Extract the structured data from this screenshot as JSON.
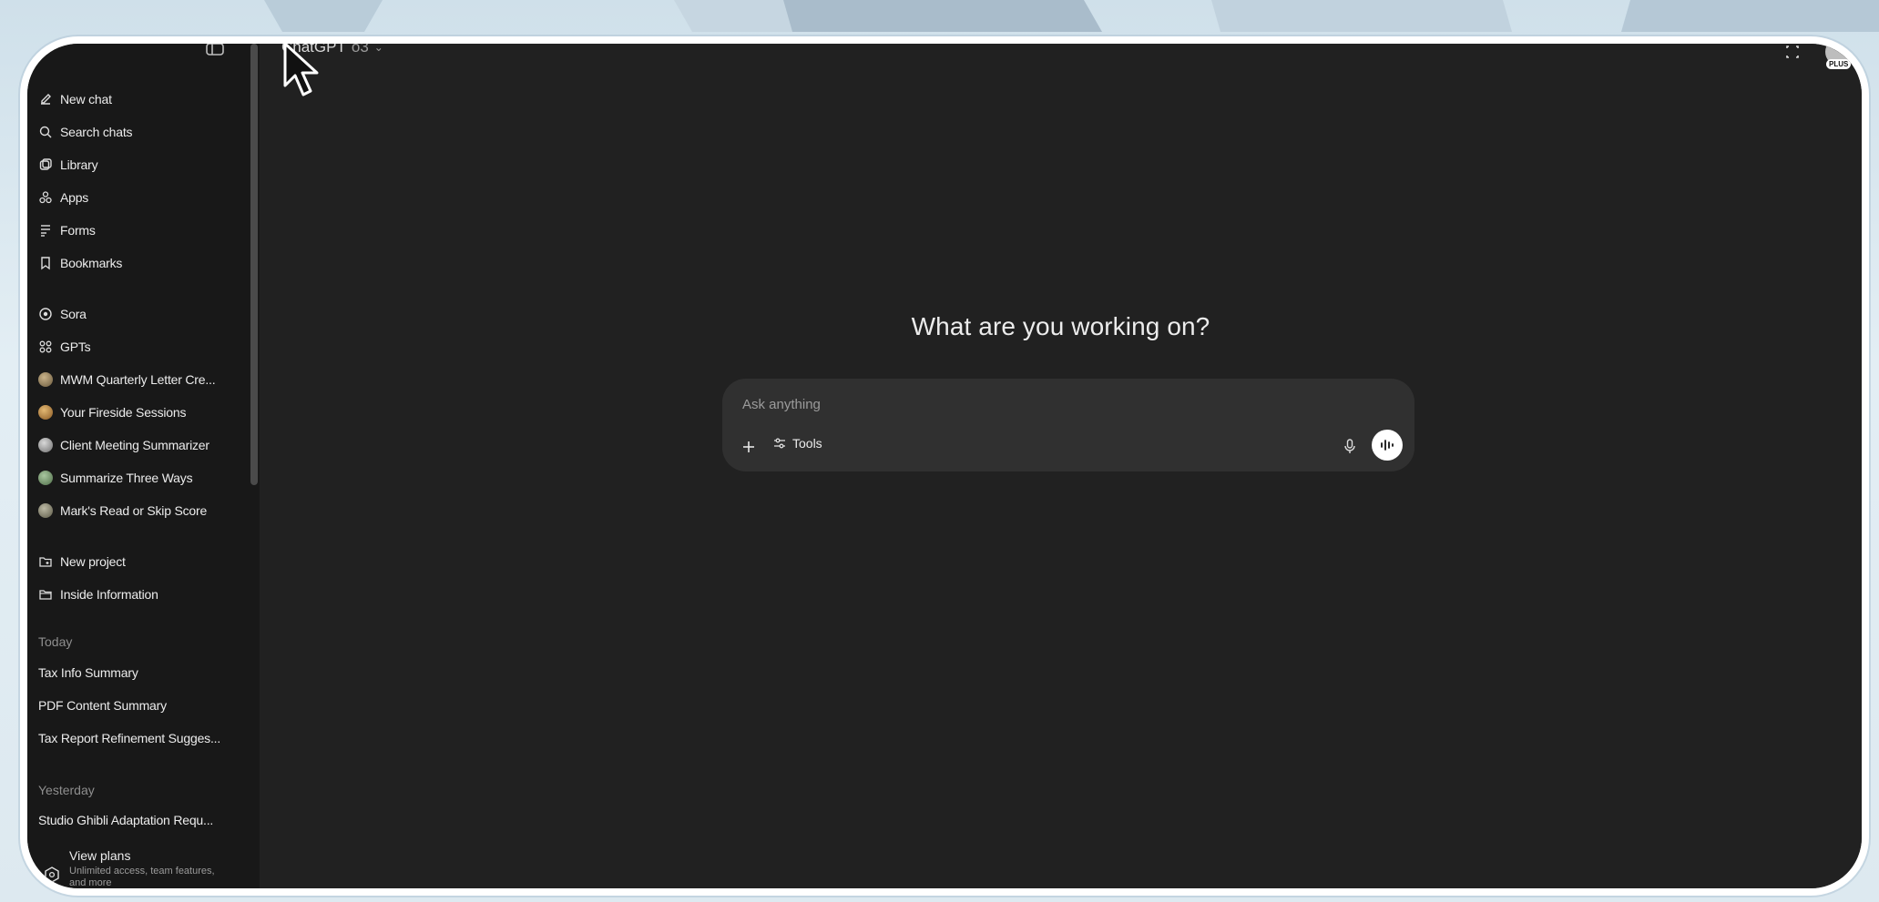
{
  "app": {
    "model_name": "ChatGPT",
    "model_version": "o3",
    "plan_badge": "PLUS"
  },
  "sidebar": {
    "nav": [
      {
        "label": "New chat",
        "icon": "edit-icon"
      },
      {
        "label": "Search chats",
        "icon": "search-icon"
      },
      {
        "label": "Library",
        "icon": "library-icon"
      },
      {
        "label": "Apps",
        "icon": "apps-icon"
      },
      {
        "label": "Forms",
        "icon": "forms-icon"
      },
      {
        "label": "Bookmarks",
        "icon": "bookmark-icon"
      }
    ],
    "explore": [
      {
        "label": "Sora",
        "icon": "sora-icon"
      },
      {
        "label": "GPTs",
        "icon": "gpts-icon"
      }
    ],
    "gpts": [
      {
        "label": "MWM Quarterly Letter Cre..."
      },
      {
        "label": "Your Fireside Sessions"
      },
      {
        "label": "Client Meeting Summarizer"
      },
      {
        "label": "Summarize Three Ways"
      },
      {
        "label": "Mark's Read or Skip Score"
      }
    ],
    "projects": [
      {
        "label": "New project",
        "icon": "new-project-icon"
      },
      {
        "label": "Inside Information",
        "icon": "folder-icon"
      }
    ],
    "today_label": "Today",
    "today": [
      "Tax Info Summary",
      "PDF Content Summary",
      "Tax Report Refinement Sugges..."
    ],
    "yesterday_label": "Yesterday",
    "yesterday": [
      "Studio Ghibli Adaptation Requ..."
    ],
    "plans": {
      "title": "View plans",
      "subtitle": "Unlimited access, team features, and more"
    }
  },
  "main": {
    "heading": "What are you working on?",
    "composer": {
      "placeholder": "Ask anything",
      "tools_label": "Tools"
    }
  },
  "colors": {
    "sidebar_bg": "#181818",
    "main_bg": "#212121",
    "composer_bg": "#303030",
    "text": "#ececec",
    "muted": "#8e8e8e"
  }
}
